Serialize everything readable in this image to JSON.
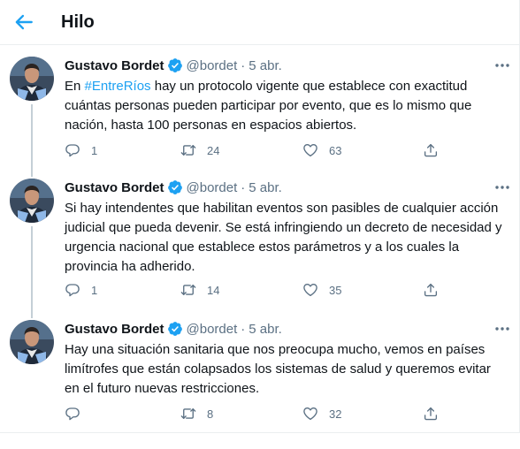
{
  "header": {
    "title": "Hilo"
  },
  "tweets": [
    {
      "name": "Gustavo Bordet",
      "handle": "@bordet",
      "separator": "·",
      "date": "5 abr.",
      "text_before": "En ",
      "hashtag": "#EntreRíos",
      "text_after": " hay un protocolo vigente que establece con exactitud cuántas personas pueden participar por evento, que es lo mismo que nación, hasta 100 personas en espacios abiertos.",
      "replies": "1",
      "retweets": "24",
      "likes": "63"
    },
    {
      "name": "Gustavo Bordet",
      "handle": "@bordet",
      "separator": "·",
      "date": "5 abr.",
      "text": "Si hay intendentes que habilitan eventos son pasibles de cualquier acción judicial que pueda devenir. Se está infringiendo un decreto de necesidad y urgencia nacional que establece estos parámetros y a los cuales la provincia ha adherido.",
      "replies": "1",
      "retweets": "14",
      "likes": "35"
    },
    {
      "name": "Gustavo Bordet",
      "handle": "@bordet",
      "separator": "·",
      "date": "5 abr.",
      "text": "Hay una situación sanitaria que nos preocupa mucho, vemos en países limítrofes que están colapsados los sistemas de salud y queremos evitar en el futuro nuevas restricciones.",
      "replies": "",
      "retweets": "8",
      "likes": "32"
    }
  ],
  "icons": {
    "back": "arrow-left-icon",
    "verified": "verified-badge-icon",
    "more": "more-horizontal-icon",
    "reply": "reply-icon",
    "retweet": "retweet-icon",
    "like": "heart-icon",
    "share": "share-icon"
  },
  "colors": {
    "accent": "#1da1f2",
    "muted": "#5b7083",
    "text": "#0f1419",
    "border": "#ebeef0",
    "thread": "#c4cfd6"
  }
}
